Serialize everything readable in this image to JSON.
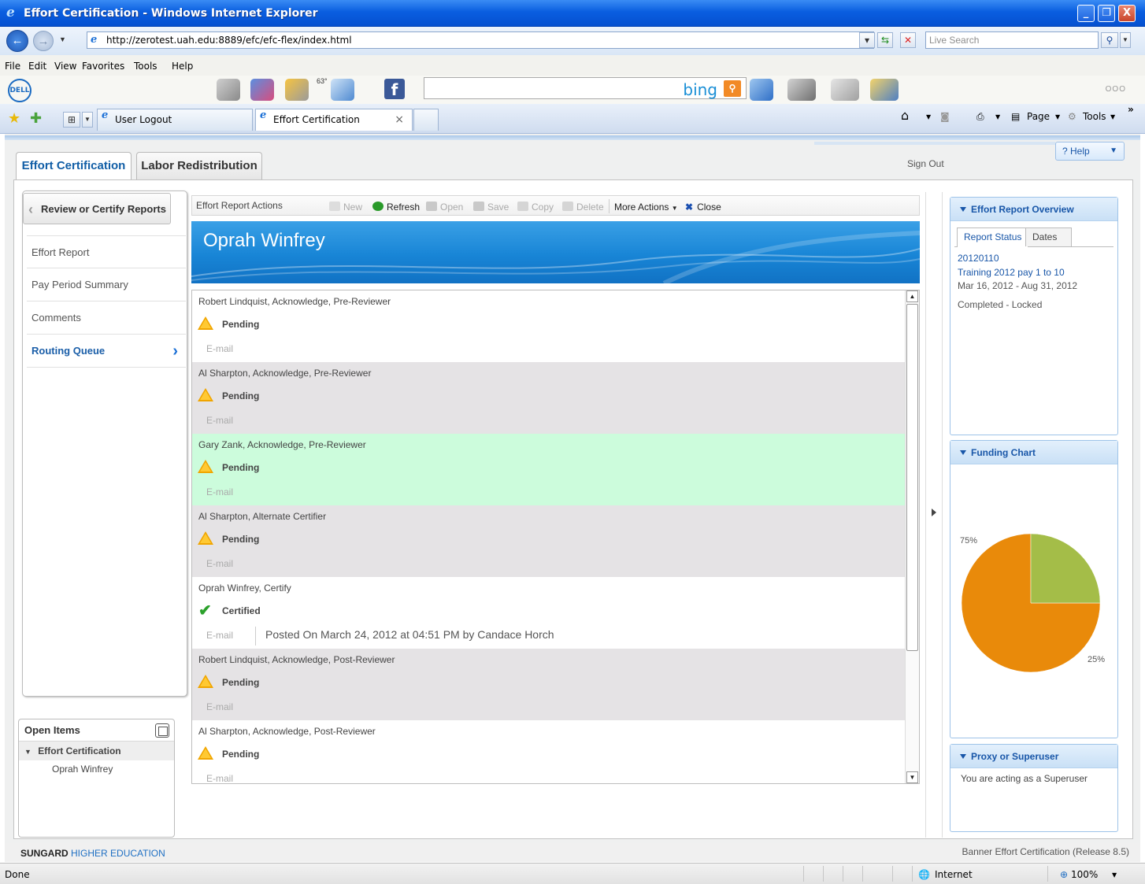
{
  "window": {
    "title": "Effort Certification - Windows Internet Explorer",
    "controls": [
      "_",
      "❐",
      "X"
    ]
  },
  "address": {
    "url": "http://zerotest.uah.edu:8889/efc/efc-flex/index.html",
    "search_placeholder": "Live Search"
  },
  "menu": [
    "File",
    "Edit",
    "View",
    "Favorites",
    "Tools",
    "Help"
  ],
  "dell": {
    "logo": "DELL",
    "weather": "63°",
    "search_brand": "bing",
    "dots": "OOO"
  },
  "browser_tabs": [
    {
      "label": "User Logout"
    },
    {
      "label": "Effort Certification",
      "close": "×"
    }
  ],
  "browser_cmds": {
    "page": "Page",
    "tools": "Tools",
    "more": "»"
  },
  "app": {
    "tabs": [
      "Effort Certification",
      "Labor Redistribution"
    ],
    "sign_out": "Sign Out",
    "help": "? Help",
    "back_button": "Review or Certify Reports",
    "nav": [
      "Effort Report",
      "Pay Period Summary",
      "Comments",
      "Routing Queue"
    ],
    "open_items": {
      "title": "Open Items",
      "group": "Effort Certification",
      "child": "Oprah Winfrey"
    },
    "actions_label": "Effort Report Actions",
    "actions": [
      "New",
      "Refresh",
      "Open",
      "Save",
      "Copy",
      "Delete",
      "More Actions",
      "Close"
    ],
    "person": "Oprah Winfrey",
    "queue": [
      {
        "who": "Robert Lindquist, Acknowledge, Pre-Reviewer",
        "status": "Pending",
        "email": "E-mail"
      },
      {
        "who": "Al Sharpton, Acknowledge, Pre-Reviewer",
        "status": "Pending",
        "email": "E-mail"
      },
      {
        "who": "Gary Zank, Acknowledge, Pre-Reviewer",
        "status": "Pending",
        "email": "E-mail"
      },
      {
        "who": "Al Sharpton, Alternate Certifier",
        "status": "Pending",
        "email": "E-mail"
      },
      {
        "who": "Oprah Winfrey, Certify",
        "status": "Certified",
        "email": "E-mail",
        "posted": "Posted On March 24, 2012 at 04:51 PM by Candace Horch"
      },
      {
        "who": "Robert Lindquist, Acknowledge, Post-Reviewer",
        "status": "Pending",
        "email": "E-mail"
      },
      {
        "who": "Al Sharpton, Acknowledge, Post-Reviewer",
        "status": "Pending",
        "email": "E-mail"
      }
    ],
    "overview": {
      "title": "Effort Report Overview",
      "tabs": [
        "Report Status",
        "Dates"
      ],
      "id": "20120110",
      "name": "Training 2012 pay 1 to 10",
      "dates": "Mar 16, 2012 - Aug 31, 2012",
      "status": "Completed - Locked"
    },
    "funding": {
      "title": "Funding Chart",
      "label_big": "75%",
      "label_small": "25%"
    },
    "proxy": {
      "title": "Proxy or Superuser",
      "text": "You are acting as a Superuser"
    },
    "footer": {
      "brand": "SUNGARD",
      "brand_sub": "HIGHER EDUCATION",
      "release": "Banner Effort Certification (Release 8.5)"
    }
  },
  "chart_data": {
    "type": "pie",
    "categories": [
      "",
      ""
    ],
    "values": [
      75,
      25
    ],
    "labels": [
      "75%",
      "25%"
    ],
    "colors": [
      "#e98a0a",
      "#a4bd48"
    ]
  },
  "statusbar": {
    "left": "Done",
    "zone": "Internet",
    "zoom": "100%"
  }
}
